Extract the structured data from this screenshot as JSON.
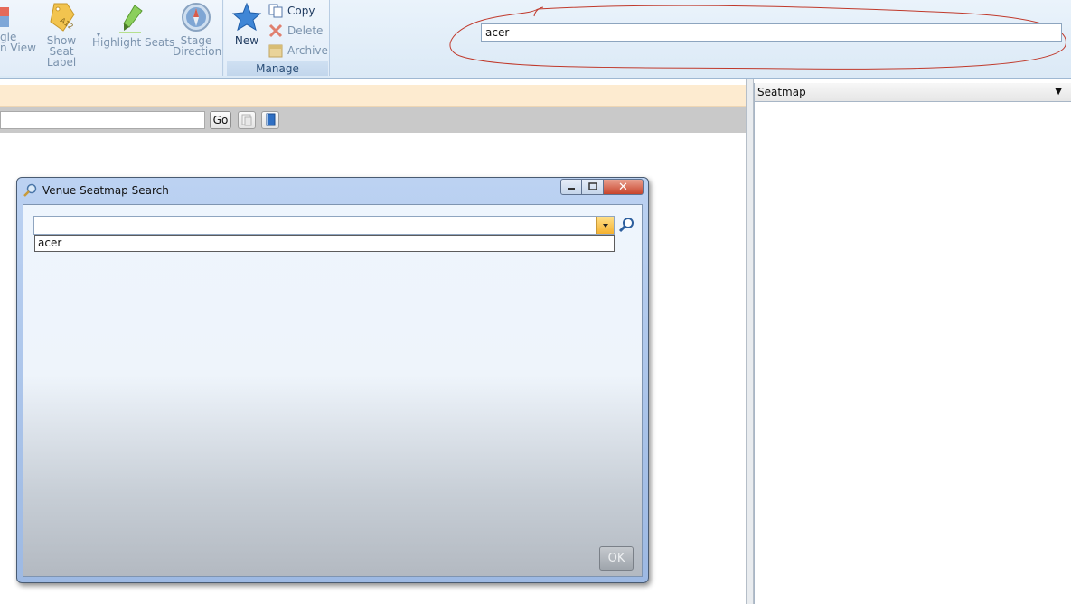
{
  "ribbon": {
    "buttons": {
      "toggle_view_line1": "gle",
      "toggle_view_line2": "n View",
      "show_seat_label_line1": "Show",
      "show_seat_label_line2": "Seat Label",
      "highlight_seats": "Highlight Seats",
      "stage_direction_line1": "Stage",
      "stage_direction_line2": "Direction",
      "new": "New",
      "copy": "Copy",
      "delete": "Delete",
      "archive": "Archive"
    },
    "manage_group_label": "Manage",
    "search_value": "acer"
  },
  "toolbar": {
    "go_label": "Go"
  },
  "right_panel": {
    "header": "Seatmap"
  },
  "dialog": {
    "title": "Venue Seatmap Search",
    "combo_value": "",
    "dropdown_items": [
      "acer"
    ],
    "ok_label": "OK"
  },
  "colors": {
    "annotation_scribble": "#c0392b",
    "close_button": "#c8442b",
    "ribbon_bg": "#dbe9f6"
  },
  "icons": [
    "toggle-view-icon",
    "tag-icon",
    "highlighter-icon",
    "compass-icon",
    "star-icon",
    "copy-icon",
    "delete-icon",
    "archive-icon",
    "magnifier-icon",
    "page-icon",
    "book-icon"
  ]
}
